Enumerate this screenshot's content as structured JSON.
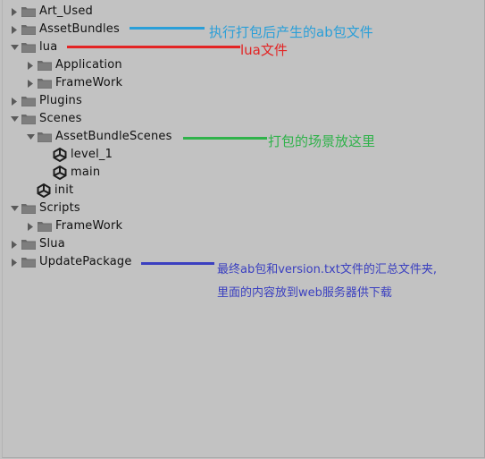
{
  "tree": [
    {
      "label": "Art_Used",
      "depth": 0,
      "expanded": false,
      "icon": "folder-icon"
    },
    {
      "label": "AssetBundles",
      "depth": 0,
      "expanded": false,
      "icon": "folder-icon"
    },
    {
      "label": "lua",
      "depth": 0,
      "expanded": true,
      "icon": "folder-icon"
    },
    {
      "label": "Application",
      "depth": 1,
      "expanded": false,
      "icon": "folder-icon"
    },
    {
      "label": "FrameWork",
      "depth": 1,
      "expanded": false,
      "icon": "folder-icon"
    },
    {
      "label": "Plugins",
      "depth": 0,
      "expanded": false,
      "icon": "folder-icon"
    },
    {
      "label": "Scenes",
      "depth": 0,
      "expanded": true,
      "icon": "folder-icon"
    },
    {
      "label": "AssetBundleScenes",
      "depth": 1,
      "expanded": true,
      "icon": "folder-icon"
    },
    {
      "label": "level_1",
      "depth": 2,
      "expanded": null,
      "icon": "unity-scene-icon"
    },
    {
      "label": "main",
      "depth": 2,
      "expanded": null,
      "icon": "unity-scene-icon"
    },
    {
      "label": "init",
      "depth": 1,
      "expanded": null,
      "icon": "unity-scene-icon"
    },
    {
      "label": "Scripts",
      "depth": 0,
      "expanded": true,
      "icon": "folder-icon"
    },
    {
      "label": "FrameWork",
      "depth": 1,
      "expanded": false,
      "icon": "folder-icon"
    },
    {
      "label": "Slua",
      "depth": 0,
      "expanded": false,
      "icon": "folder-icon"
    },
    {
      "label": "UpdatePackage",
      "depth": 0,
      "expanded": false,
      "icon": "folder-icon"
    }
  ],
  "annotations": {
    "assetbundles": {
      "text": "执行打包后产生的ab包文件",
      "color": "#2a9fd8"
    },
    "lua": {
      "text": "lua文件",
      "color": "#e32424"
    },
    "scenes": {
      "text": "打包的场景放这里",
      "color": "#2fb24a"
    },
    "update_line1": "最终ab包和version.txt文件的汇总文件夹,",
    "update_line2": "里面的内容放到web服务器供下载",
    "update_color": "#3a3fc0"
  }
}
